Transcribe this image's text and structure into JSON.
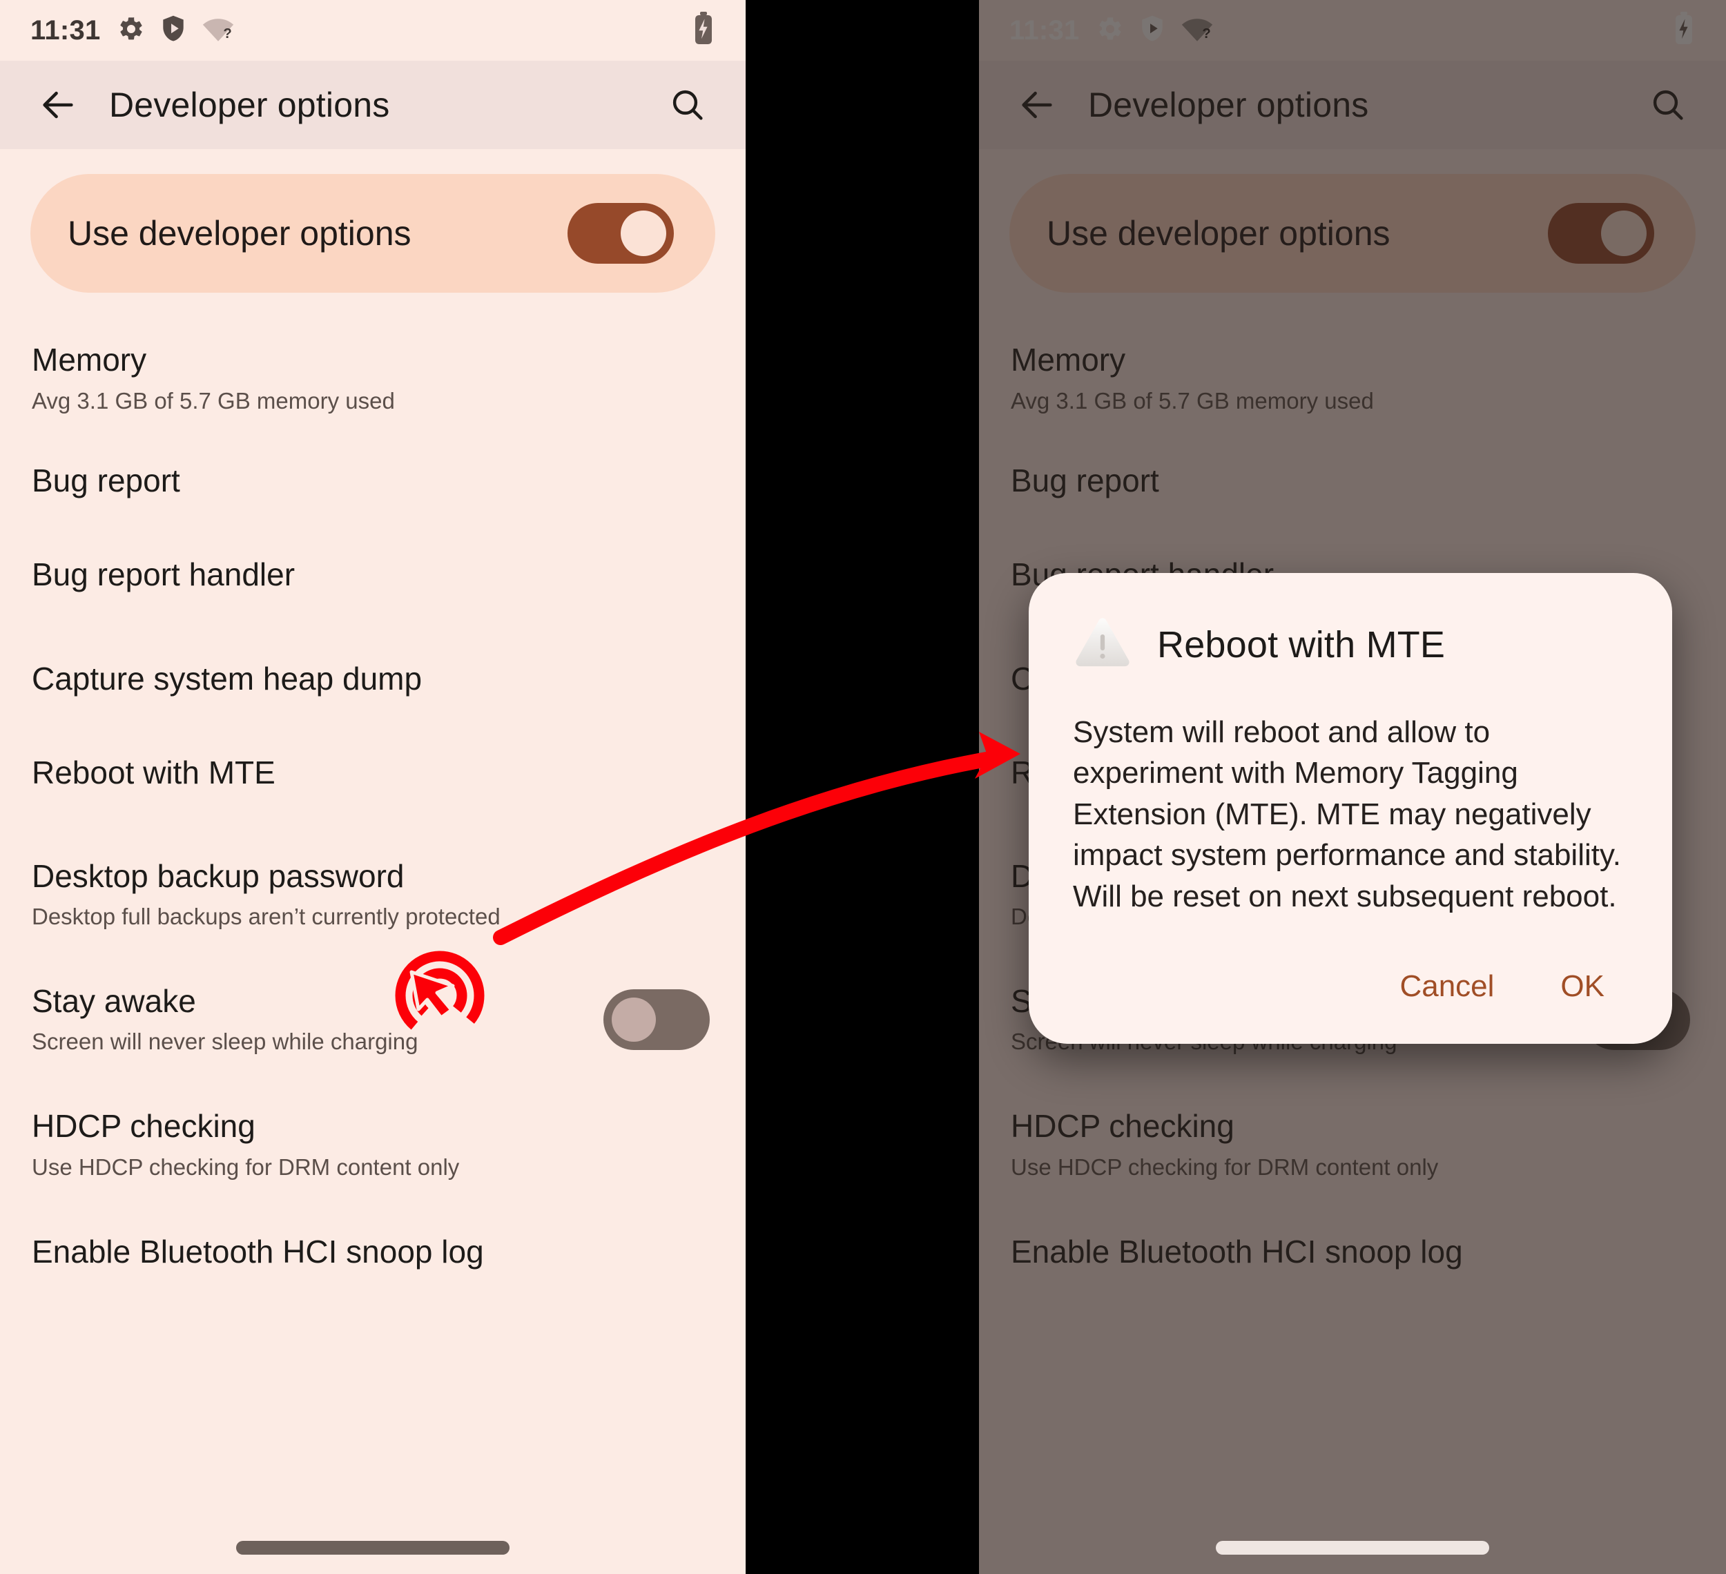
{
  "colors": {
    "surface": "#FCEBE4",
    "toolbar_bg": "#F1E0DC",
    "hero_bg": "#FBD6C2",
    "switch_on_track": "#96492A",
    "switch_on_knob": "#FBE2D6",
    "switch_off_track": "#7A6A63",
    "switch_off_knob": "#C4ACA6",
    "dialog_bg": "#FEF2EE",
    "accent": "#A04E26",
    "annotation_red": "#FC0008",
    "gap_black": "#000000",
    "scrim": "rgba(40,32,29,0.62)"
  },
  "left_phone": {
    "status_bar": {
      "time": "11:31",
      "icons": [
        "gear-icon",
        "shield-play-icon",
        "wifi-question-icon"
      ],
      "battery": "battery-charging-icon"
    },
    "toolbar": {
      "back": "back-arrow-icon",
      "title": "Developer options",
      "search": "search-icon"
    },
    "hero": {
      "label": "Use developer options",
      "toggle_state": "on"
    },
    "rows": [
      {
        "title": "Memory",
        "sub": "Avg 3.1 GB of 5.7 GB memory used",
        "toggle": ""
      },
      {
        "title": "Bug report",
        "sub": "",
        "toggle": ""
      },
      {
        "title": "Bug report handler",
        "sub": "",
        "toggle": ""
      },
      {
        "title": "Capture system heap dump",
        "sub": "",
        "toggle": ""
      },
      {
        "title": "Reboot with MTE",
        "sub": "",
        "toggle": ""
      },
      {
        "title": "Desktop backup password",
        "sub": "Desktop full backups aren’t currently protected",
        "toggle": ""
      },
      {
        "title": "Stay awake",
        "sub": "Screen will never sleep while charging",
        "toggle": "off"
      },
      {
        "title": "HDCP checking",
        "sub": "Use HDCP checking for DRM content only",
        "toggle": ""
      },
      {
        "title": "Enable Bluetooth HCI snoop log",
        "sub": "",
        "toggle": ""
      }
    ]
  },
  "right_phone": {
    "status_bar": {
      "time": "11:31",
      "icons": [
        "gear-icon",
        "shield-play-icon",
        "wifi-question-icon"
      ],
      "battery": "battery-charging-icon"
    },
    "toolbar": {
      "back": "back-arrow-icon",
      "title": "Developer options",
      "search": "search-icon"
    },
    "hero": {
      "label": "Use developer options",
      "toggle_state": "on"
    },
    "rows": [
      {
        "title": "Memory",
        "sub": "Avg 3.1 GB of 5.7 GB memory used",
        "toggle": ""
      },
      {
        "title": "Bug report",
        "sub": "",
        "toggle": ""
      },
      {
        "title": "Bug report handler",
        "sub": "",
        "toggle": ""
      },
      {
        "title": "Capture system heap dump",
        "sub": "",
        "toggle": ""
      },
      {
        "title": "Reboot with MTE",
        "sub": "",
        "toggle": ""
      },
      {
        "title": "Desktop backup password",
        "sub": "Desktop full backups aren’t currently protected",
        "toggle": ""
      },
      {
        "title": "Stay awake",
        "sub": "Screen will never sleep while charging",
        "toggle": "off"
      },
      {
        "title": "HDCP checking",
        "sub": "Use HDCP checking for DRM content only",
        "toggle": ""
      },
      {
        "title": "Enable Bluetooth HCI snoop log",
        "sub": "",
        "toggle": ""
      }
    ],
    "dialog": {
      "icon": "warning-triangle-icon",
      "title": "Reboot with MTE",
      "message": "System will reboot and allow to experiment with Memory Tagging Extension (MTE). MTE may negatively impact system performance and stability. Will be reset on next subsequent reboot.",
      "cancel_label": "Cancel",
      "ok_label": "OK"
    }
  },
  "annotation": {
    "click_target": "click-cursor-indicator",
    "arrow": "curved-arrow-left-to-right"
  }
}
